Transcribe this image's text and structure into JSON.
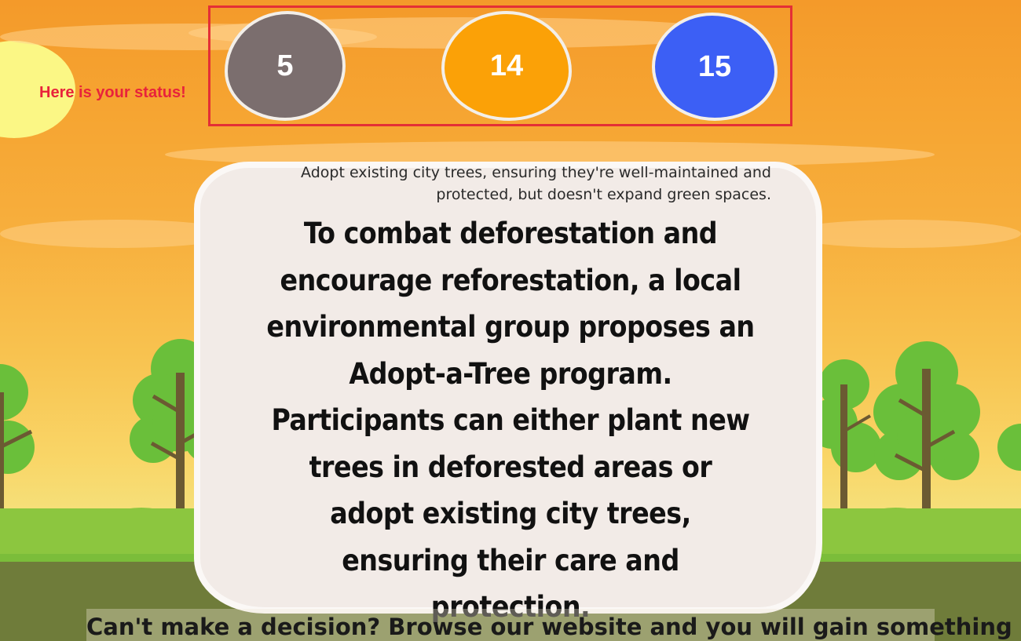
{
  "status": {
    "label": "Here is your status!",
    "values": [
      {
        "value": "5",
        "color": "#7b6e6e"
      },
      {
        "value": "14",
        "color": "#fba107"
      },
      {
        "value": "15",
        "color": "#3c5ff5"
      }
    ],
    "frame_color": "#e42f36"
  },
  "card": {
    "option": "Adopt existing city trees, ensuring they're well-maintained and protected,  but doesn't expand green spaces.",
    "scenario": "To combat deforestation and encourage reforestation, a local environmental group proposes an Adopt-a-Tree program. Participants can either plant new trees in deforested areas or adopt existing city trees, ensuring their care and protection."
  },
  "footer": {
    "hint": "Can't make a decision? Browse our website and you will gain something"
  },
  "scene": {
    "sky_colors": [
      "#f49a2a",
      "#f9d668"
    ],
    "grass_color": "#8cc63f",
    "tree_foliage_color": "#6abf3a",
    "tree_trunk_color": "#6b5a32",
    "sun_color": "#fbf785"
  }
}
